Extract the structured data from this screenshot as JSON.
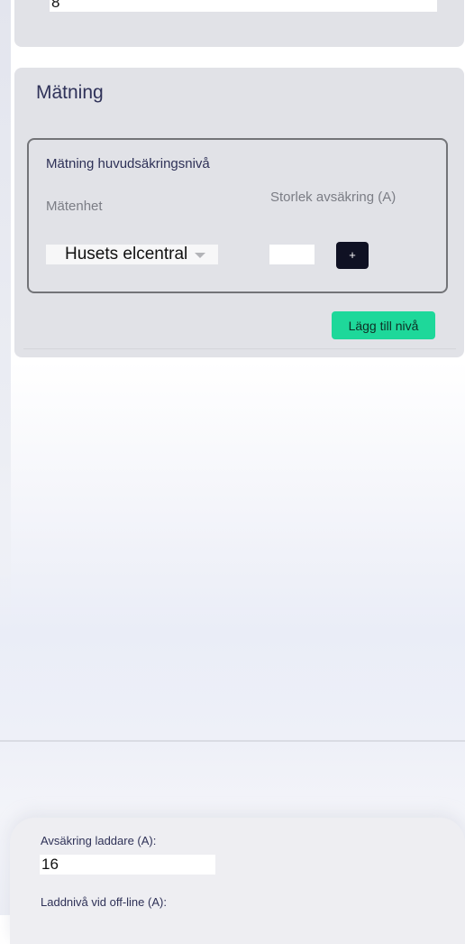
{
  "top_card": {
    "field_value": "8"
  },
  "matning": {
    "title": "Mätning",
    "level": {
      "title": "Mätning huvudsäkringsnivå",
      "unit_label": "Mätenhet",
      "fuse_size_label": "Storlek avsäkring (A)",
      "unit_select_value": "Husets elcentral",
      "fuse_size_value": "",
      "plus_label": "+"
    },
    "add_level_label": "Lägg till nivå"
  },
  "charger": {
    "fuse_label": "Avsäkring laddare (A):",
    "fuse_value": "16",
    "offline_label": "Laddnivå vid off-line (A):"
  },
  "colors": {
    "accent_green": "#1ed89a",
    "dark_button": "#0f1123",
    "card_background": "#e1e2e7",
    "heading_text": "#2f3259"
  },
  "icons": {
    "select_arrow": "chevron-down-icon"
  }
}
